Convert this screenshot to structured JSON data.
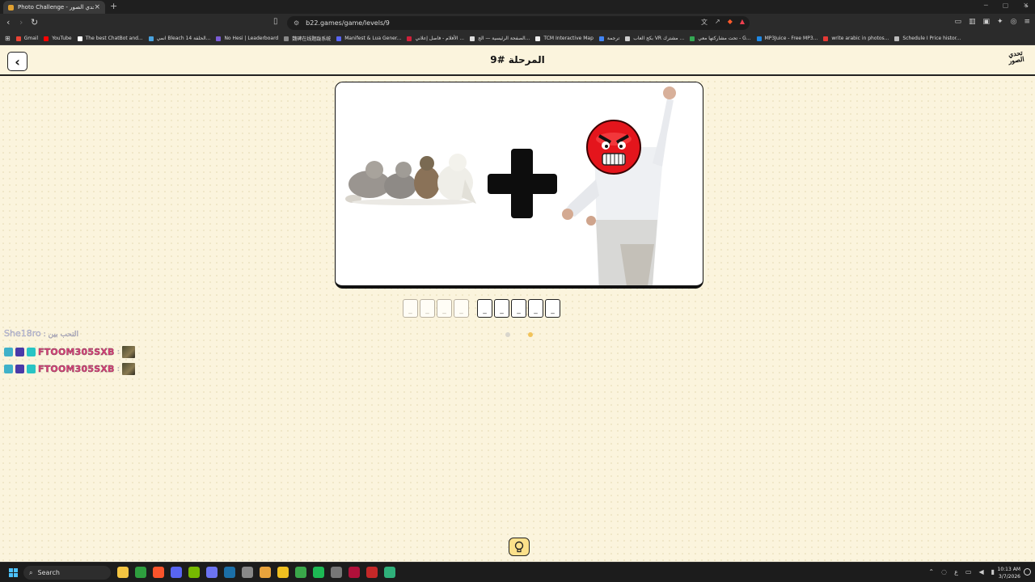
{
  "browser": {
    "tab_title": "Photo Challenge - لعبة تحدي الصور",
    "url": "b22.games/game/levels/9",
    "bookmarks": [
      {
        "label": "Gmail",
        "color": "#ea4335"
      },
      {
        "label": "YouTube",
        "color": "#ff0000"
      },
      {
        "label": "The best ChatBot and...",
        "color": "#ffffff"
      },
      {
        "label": "انمي Bleach الحلقة 14...",
        "color": "#4aa3df"
      },
      {
        "label": "No Hesi | Leaderboard",
        "color": "#7b5cd6"
      },
      {
        "label": "魏碑在线题跋系统",
        "color": "#888888"
      },
      {
        "label": "Manifest & Lua Gener...",
        "color": "#5865f2"
      },
      {
        "label": "الأفلام - فاصل إعلاني ...",
        "color": "#d0203a"
      },
      {
        "label": "الصفحة الرئيسية — الج...",
        "color": "#dddddd"
      },
      {
        "label": "TCM Interactive Map",
        "color": "#eeeeee"
      },
      {
        "label": "ترجمة",
        "color": "#4285f4"
      },
      {
        "label": "بكج العاب VR مشترك ...",
        "color": "#cccccc"
      },
      {
        "label": "تحت مشاركتها معي - G...",
        "color": "#34a853"
      },
      {
        "label": "MP3Juice - Free MP3...",
        "color": "#1e88e5"
      },
      {
        "label": "write arabic in photos...",
        "color": "#e53935"
      },
      {
        "label": "Schedule I Price histor...",
        "color": "#bbbbbb"
      }
    ]
  },
  "header": {
    "back_icon": "‹",
    "level_title": "المرحلة #9",
    "logo_line1": "تحدي",
    "logo_line2": "الصور"
  },
  "answer": {
    "word1": [
      "_",
      "_",
      "_",
      "_"
    ],
    "word2": [
      "_",
      "_",
      "_",
      "_",
      "_"
    ]
  },
  "chat": {
    "top_name": "She18ro",
    "top_label": ": التحب بين",
    "lines": [
      {
        "name": "FTOOM305SXB",
        "sep": ":"
      },
      {
        "name": "FTOOM305SXB",
        "sep": ":"
      }
    ]
  },
  "taskbar": {
    "search_label": "Search",
    "time": "10:13 AM",
    "date": "3/7/2026",
    "lang": "ع"
  },
  "colors": {
    "background": "#fbf4dd",
    "hint_button": "#fbe08a",
    "username": "#e0447b",
    "active_dot": "#f1c35a"
  }
}
